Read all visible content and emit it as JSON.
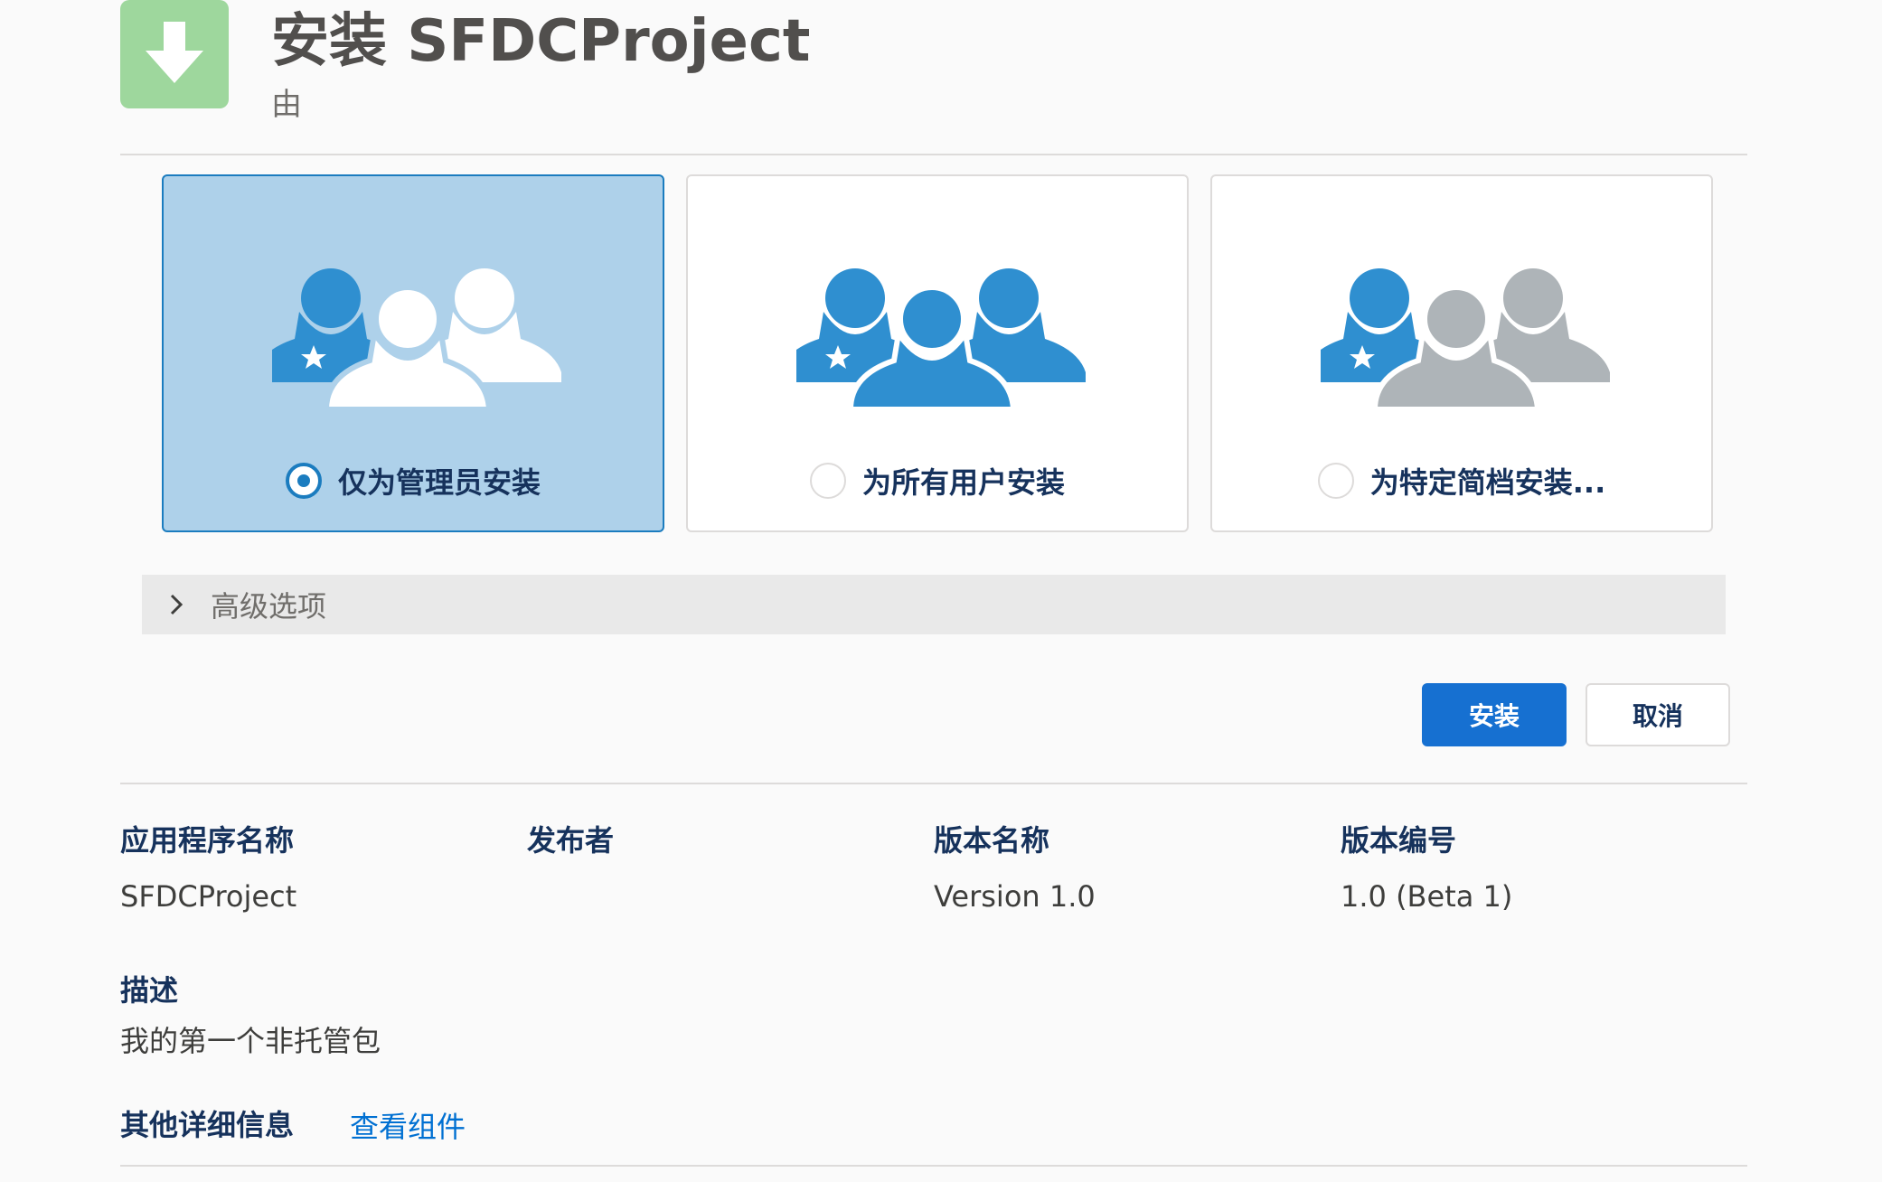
{
  "header": {
    "icon": "download-arrow-icon",
    "title": "安装 SFDCProject",
    "byline": "由"
  },
  "install_options": [
    {
      "label": "仅为管理员安装",
      "selected": true,
      "icon": "users-admin-only-icon"
    },
    {
      "label": "为所有用户安装",
      "selected": false,
      "icon": "users-all-icon"
    },
    {
      "label": "为特定简档安装...",
      "selected": false,
      "icon": "users-specific-profiles-icon"
    }
  ],
  "advanced": {
    "label": "高级选项",
    "icon": "chevron-right-icon"
  },
  "buttons": {
    "install": "安装",
    "cancel": "取消"
  },
  "details": {
    "app_name_label": "应用程序名称",
    "app_name_value": "SFDCProject",
    "publisher_label": "发布者",
    "publisher_value": "",
    "version_name_label": "版本名称",
    "version_name_value": "Version 1.0",
    "version_number_label": "版本编号",
    "version_number_value": "1.0 (Beta 1)",
    "description_label": "描述",
    "description_value": "我的第一个非托管包",
    "other_info_label": "其他详细信息",
    "view_components_link": "查看组件"
  },
  "colors": {
    "accent_blue": "#1b7cbf",
    "primary_button": "#1670d1",
    "selected_card": "#aed1ea",
    "person_blue": "#2f8fd0",
    "person_grey": "#aeb4b8",
    "header_icon_green": "#9ed79d"
  }
}
